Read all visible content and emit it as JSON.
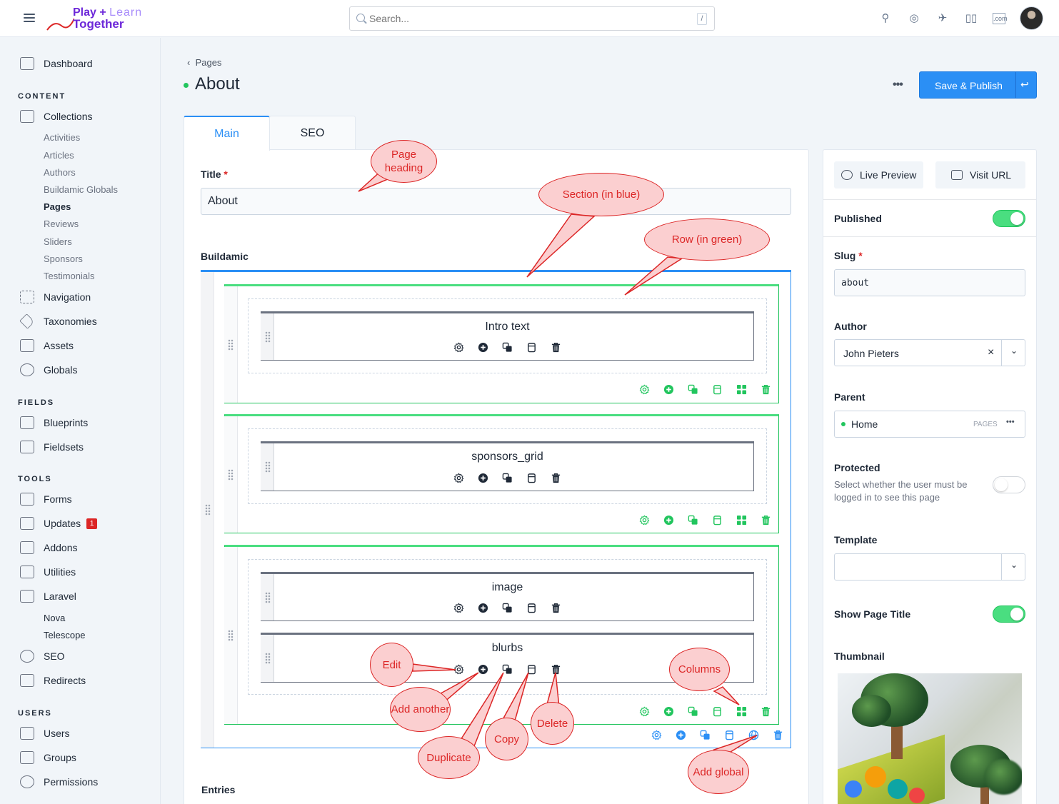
{
  "app": {
    "logo_line1": "Play",
    "logo_plus": "+",
    "logo_learn": "Learn",
    "logo_line2": "Together"
  },
  "search": {
    "placeholder": "Search...",
    "shortcut": "/"
  },
  "sidebar": {
    "dashboard": "Dashboard",
    "content_heading": "CONTENT",
    "collections": "Collections",
    "collection_items": [
      "Activities",
      "Articles",
      "Authors",
      "Buildamic Globals",
      "Pages",
      "Reviews",
      "Sliders",
      "Sponsors",
      "Testimonials"
    ],
    "navigation": "Navigation",
    "taxonomies": "Taxonomies",
    "assets": "Assets",
    "globals": "Globals",
    "fields_heading": "FIELDS",
    "blueprints": "Blueprints",
    "fieldsets": "Fieldsets",
    "tools_heading": "TOOLS",
    "forms": "Forms",
    "updates": "Updates",
    "updates_badge": "1",
    "addons": "Addons",
    "utilities": "Utilities",
    "laravel": "Laravel",
    "laravel_items": [
      "Nova",
      "Telescope"
    ],
    "seo": "SEO",
    "redirects": "Redirects",
    "users_heading": "USERS",
    "users": "Users",
    "groups": "Groups",
    "permissions": "Permissions"
  },
  "header": {
    "breadcrumb": "Pages",
    "title": "About",
    "more": "•••",
    "save_publish": "Save & Publish",
    "return_icon": "↩"
  },
  "tabs": [
    {
      "label": "Main"
    },
    {
      "label": "SEO"
    }
  ],
  "form": {
    "title_label": "Title",
    "required_mark": "*",
    "title_value": "About",
    "buildamic_label": "Buildamic",
    "entries_label": "Entries"
  },
  "buildamic": {
    "fields": [
      "Intro text",
      "sponsors_grid",
      "image",
      "blurbs"
    ],
    "field_actions": [
      "gear-icon",
      "plus-circle-icon",
      "duplicate-icon",
      "copy-icon",
      "trash-icon"
    ],
    "row_actions": [
      "gear-icon",
      "plus-circle-icon",
      "duplicate-icon",
      "copy-icon",
      "columns-icon",
      "trash-icon"
    ],
    "section_actions": [
      "gear-icon",
      "plus-circle-icon",
      "duplicate-icon",
      "copy-icon",
      "globe-icon",
      "trash-icon"
    ],
    "colors": {
      "section": "#2b8ff5",
      "row": "#22c55e",
      "field": "#6b7280"
    }
  },
  "right": {
    "live_preview": "Live Preview",
    "visit_url": "Visit URL",
    "published_label": "Published",
    "published_on": true,
    "slug_label": "Slug",
    "slug_value": "about",
    "author_label": "Author",
    "author_value": "John Pieters",
    "author_clear": "×",
    "parent_label": "Parent",
    "parent_value": "Home",
    "parent_badge": "PAGES",
    "parent_more": "•••",
    "protected_label": "Protected",
    "protected_help": "Select whether the user must be logged in to see this page",
    "protected_on": false,
    "template_label": "Template",
    "template_value": "",
    "show_title_label": "Show Page Title",
    "show_title_on": true,
    "thumbnail_label": "Thumbnail"
  },
  "annotations": {
    "page_heading": "Page heading",
    "section": "Section (in blue)",
    "row": "Row (in green)",
    "edit": "Edit",
    "add_another": "Add another",
    "duplicate": "Duplicate",
    "copy": "Copy",
    "delete": "Delete",
    "columns": "Columns",
    "add_global": "Add global"
  }
}
